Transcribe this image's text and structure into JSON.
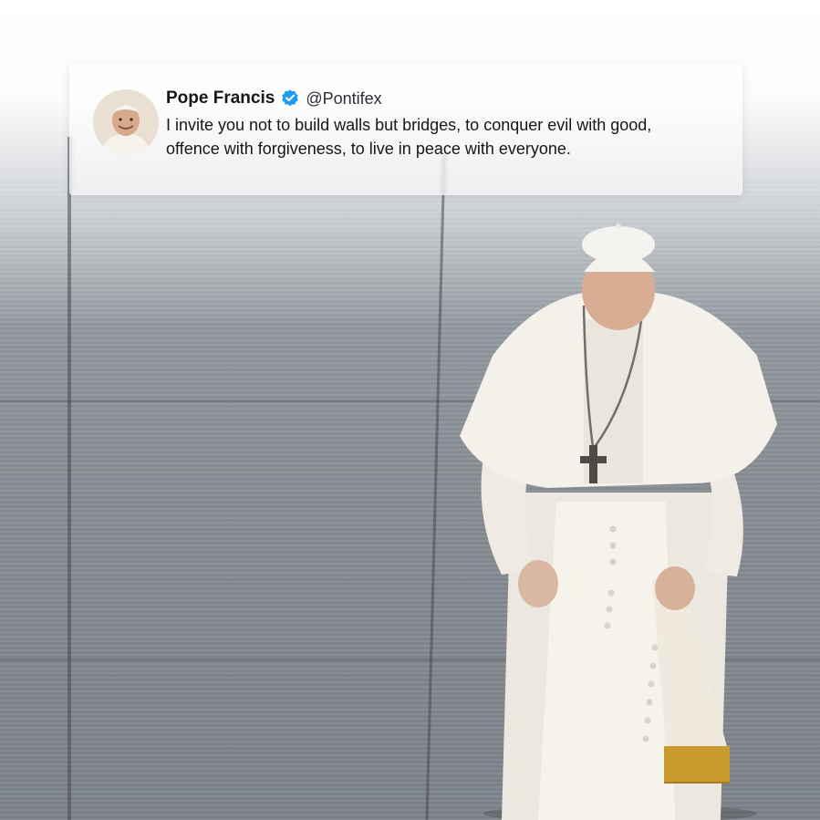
{
  "tweet": {
    "display_name": "Pope Francis",
    "handle": "@Pontifex",
    "text": "I invite you not to build walls but bridges, to conquer evil with good,\noffence with forgiveness, to live in peace with everyone.",
    "verified_icon": "verified-badge-icon",
    "verified_color": "#1d9bf0"
  },
  "avatar": {
    "icon": "profile-photo-pope-francis"
  },
  "background": {
    "description_icon": "stone-pavement",
    "figure": "pope-in-white-vestments"
  },
  "colors": {
    "card_background": "#ffffff",
    "text_primary": "#14171a",
    "handle_text": "#2a2f35",
    "cassock_white": "#f2efe8",
    "fringe_gold": "#c99a2e"
  }
}
